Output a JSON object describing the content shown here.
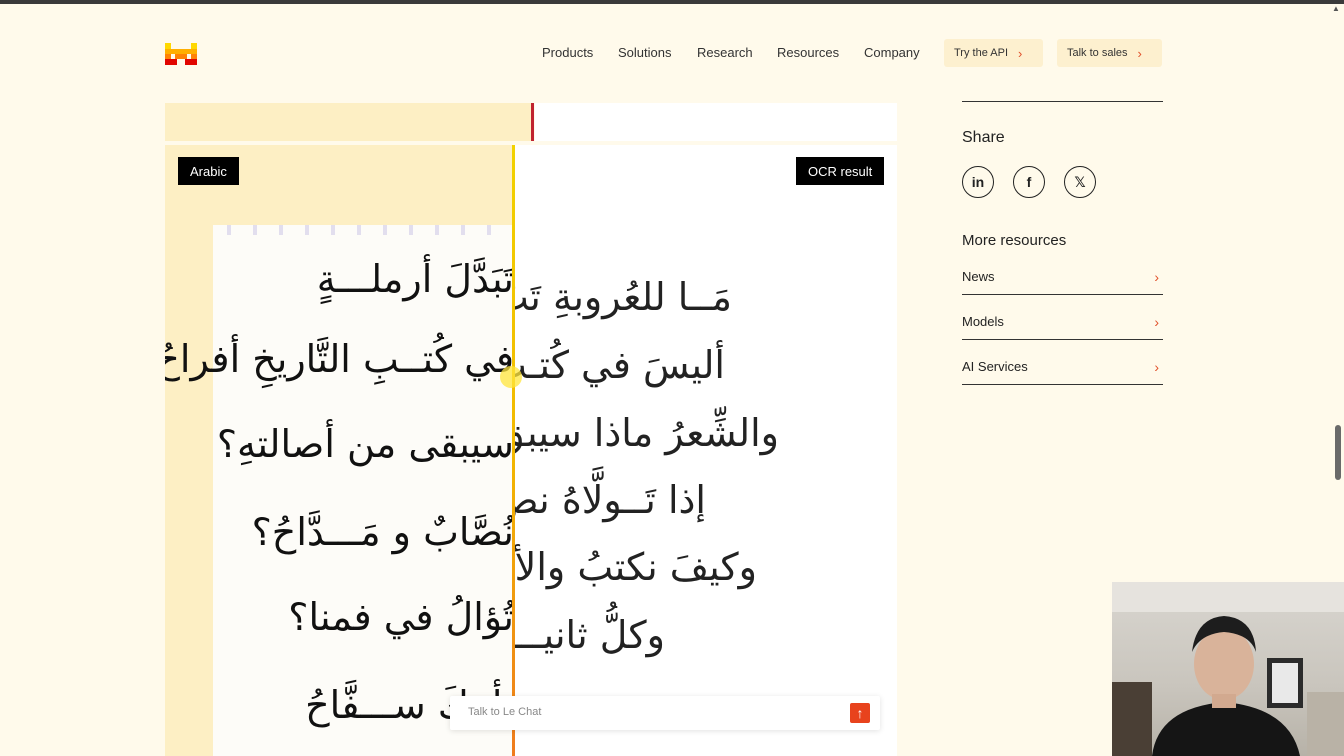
{
  "header": {
    "nav": [
      "Products",
      "Solutions",
      "Research",
      "Resources",
      "Company"
    ],
    "try_api_label": "Try the API",
    "talk_sales_label": "Talk to sales"
  },
  "comparison": {
    "left_tag": "Arabic",
    "right_tag": "OCR result",
    "scan_lines": [
      "تَبَدَّلَ أرملـــةٍ",
      "في كُتــبِ التَّاريخِ أفراحُ؟",
      "سيبقى من أصالتهِ؟",
      "نُصَّابٌ و مَـــدَّاحُ؟",
      "تُؤالُ في فمنا؟",
      "يأتيكَ ســـفَّاحُ"
    ],
    "ocr_lines": [
      "مَــا للعُروبةِ تَبَ",
      "أليسَ في كُتـب",
      "والشِّعرُ ماذا سيبق",
      "إذا تَــولَّاهُ نص",
      "وكيفَ نكتبُ والأ",
      "وكلُّ ثانيـــة"
    ]
  },
  "chat": {
    "placeholder": "Talk to Le Chat",
    "send_icon": "arrow-up-icon"
  },
  "sidebar": {
    "share_title": "Share",
    "social": [
      {
        "label": "in",
        "icon": "linkedin-icon"
      },
      {
        "label": "f",
        "icon": "facebook-icon"
      },
      {
        "label": "𝕏",
        "icon": "x-icon"
      }
    ],
    "more_title": "More resources",
    "resources": [
      "News",
      "Models",
      "AI Services"
    ]
  },
  "colors": {
    "page_bg": "#fffaeb",
    "accent": "#e0502a",
    "pill_bg": "#fdf0cf",
    "divider": "#f2b800"
  }
}
